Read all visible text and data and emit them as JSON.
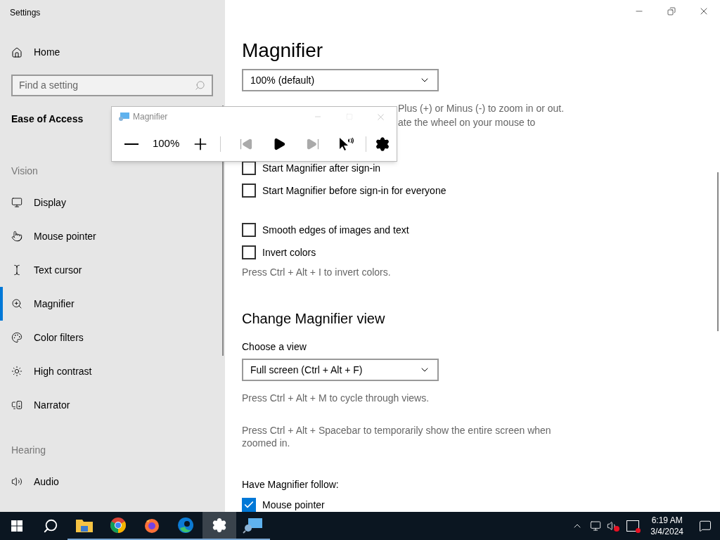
{
  "window": {
    "title": "Settings"
  },
  "sidebar": {
    "home": "Home",
    "search": {
      "placeholder": "Find a setting"
    },
    "section": "Ease of Access",
    "groups": [
      {
        "label": "Vision",
        "items": [
          {
            "label": "Display",
            "selected": false
          },
          {
            "label": "Mouse pointer",
            "selected": false
          },
          {
            "label": "Text cursor",
            "selected": false
          },
          {
            "label": "Magnifier",
            "selected": true
          },
          {
            "label": "Color filters",
            "selected": false
          },
          {
            "label": "High contrast",
            "selected": false
          },
          {
            "label": "Narrator",
            "selected": false
          }
        ]
      },
      {
        "label": "Hearing",
        "items": [
          {
            "label": "Audio",
            "selected": false
          }
        ]
      }
    ]
  },
  "main": {
    "title": "Magnifier",
    "zoom_dropdown": {
      "value": "100% (default)"
    },
    "zoom_hint_fragments": [
      "Plus (+) or Minus (-) to zoom in or out.",
      "ate the wheel on your mouse to"
    ],
    "startup_options": [
      {
        "label": "Start Magnifier after sign-in",
        "checked": false
      },
      {
        "label": "Start Magnifier before sign-in for everyone",
        "checked": false
      }
    ],
    "display_options": [
      {
        "label": "Smooth edges of images and text",
        "checked": false
      },
      {
        "label": "Invert colors",
        "checked": false
      }
    ],
    "invert_hint": "Press Ctrl + Alt + I to invert colors.",
    "view_heading": "Change Magnifier view",
    "view_label": "Choose a view",
    "view_dropdown": {
      "value": "Full screen (Ctrl + Alt + F)"
    },
    "view_hints": [
      "Press Ctrl + Alt + M to cycle through views.",
      "Press Ctrl + Alt + Spacebar to temporarily show the entire screen when zoomed in."
    ],
    "follow_label": "Have Magnifier follow:",
    "follow_options": [
      {
        "label": "Mouse pointer",
        "checked": true
      }
    ]
  },
  "magnifier_window": {
    "title": "Magnifier",
    "zoom": "100%",
    "reading_controls": [
      {
        "kind": "previous",
        "disabled": true
      },
      {
        "kind": "play",
        "disabled": false
      },
      {
        "kind": "next",
        "disabled": true
      }
    ]
  },
  "taskbar": {
    "apps": [
      {
        "kind": "explorer",
        "active": false
      },
      {
        "kind": "chrome",
        "active": false
      },
      {
        "kind": "firefox",
        "active": false
      },
      {
        "kind": "edge",
        "active": false
      },
      {
        "kind": "settings",
        "active": true
      },
      {
        "kind": "magnifier",
        "active": false
      }
    ],
    "time": "6:19 AM",
    "date": "3/4/2024"
  }
}
